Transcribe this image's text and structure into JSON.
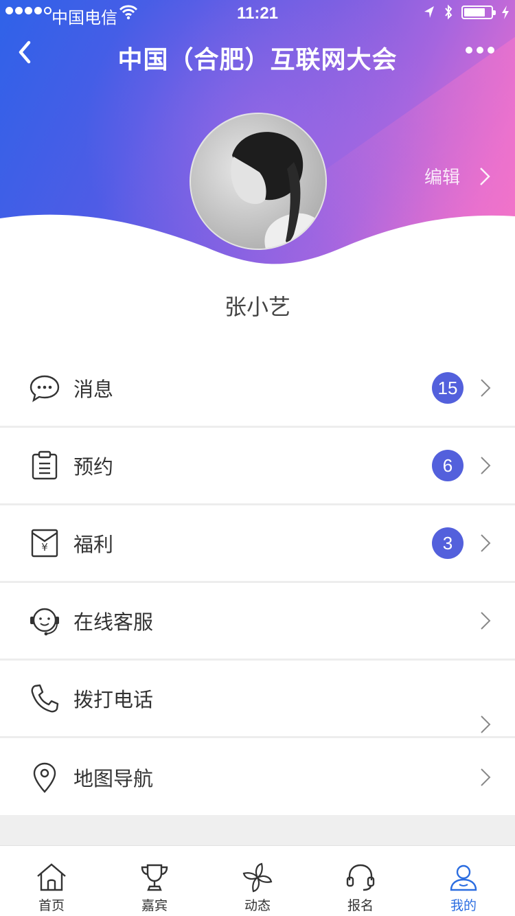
{
  "status_bar": {
    "carrier": "中国电信",
    "time": "11:21"
  },
  "navbar": {
    "title": "中国（合肥）互联网大会"
  },
  "profile": {
    "edit_label": "编辑",
    "username": "张小艺"
  },
  "menu": [
    {
      "label": "消息",
      "badge": "15",
      "icon": "message-icon"
    },
    {
      "label": "预约",
      "badge": "6",
      "icon": "clipboard-icon"
    },
    {
      "label": "福利",
      "badge": "3",
      "icon": "red-envelope-icon"
    },
    {
      "label": "在线客服",
      "badge": "",
      "icon": "customer-service-icon"
    },
    {
      "label": "拨打电话",
      "badge": "",
      "icon": "phone-icon"
    },
    {
      "label": "地图导航",
      "badge": "",
      "icon": "map-pin-icon"
    }
  ],
  "tabbar": [
    {
      "label": "首页",
      "icon": "home-icon",
      "active": false
    },
    {
      "label": "嘉宾",
      "icon": "trophy-icon",
      "active": false
    },
    {
      "label": "动态",
      "icon": "pinwheel-icon",
      "active": false
    },
    {
      "label": "报名",
      "icon": "headset-icon",
      "active": false
    },
    {
      "label": "我的",
      "icon": "user-icon",
      "active": true
    }
  ],
  "colors": {
    "accent": "#5360dc",
    "tab_active": "#2b6de0"
  }
}
